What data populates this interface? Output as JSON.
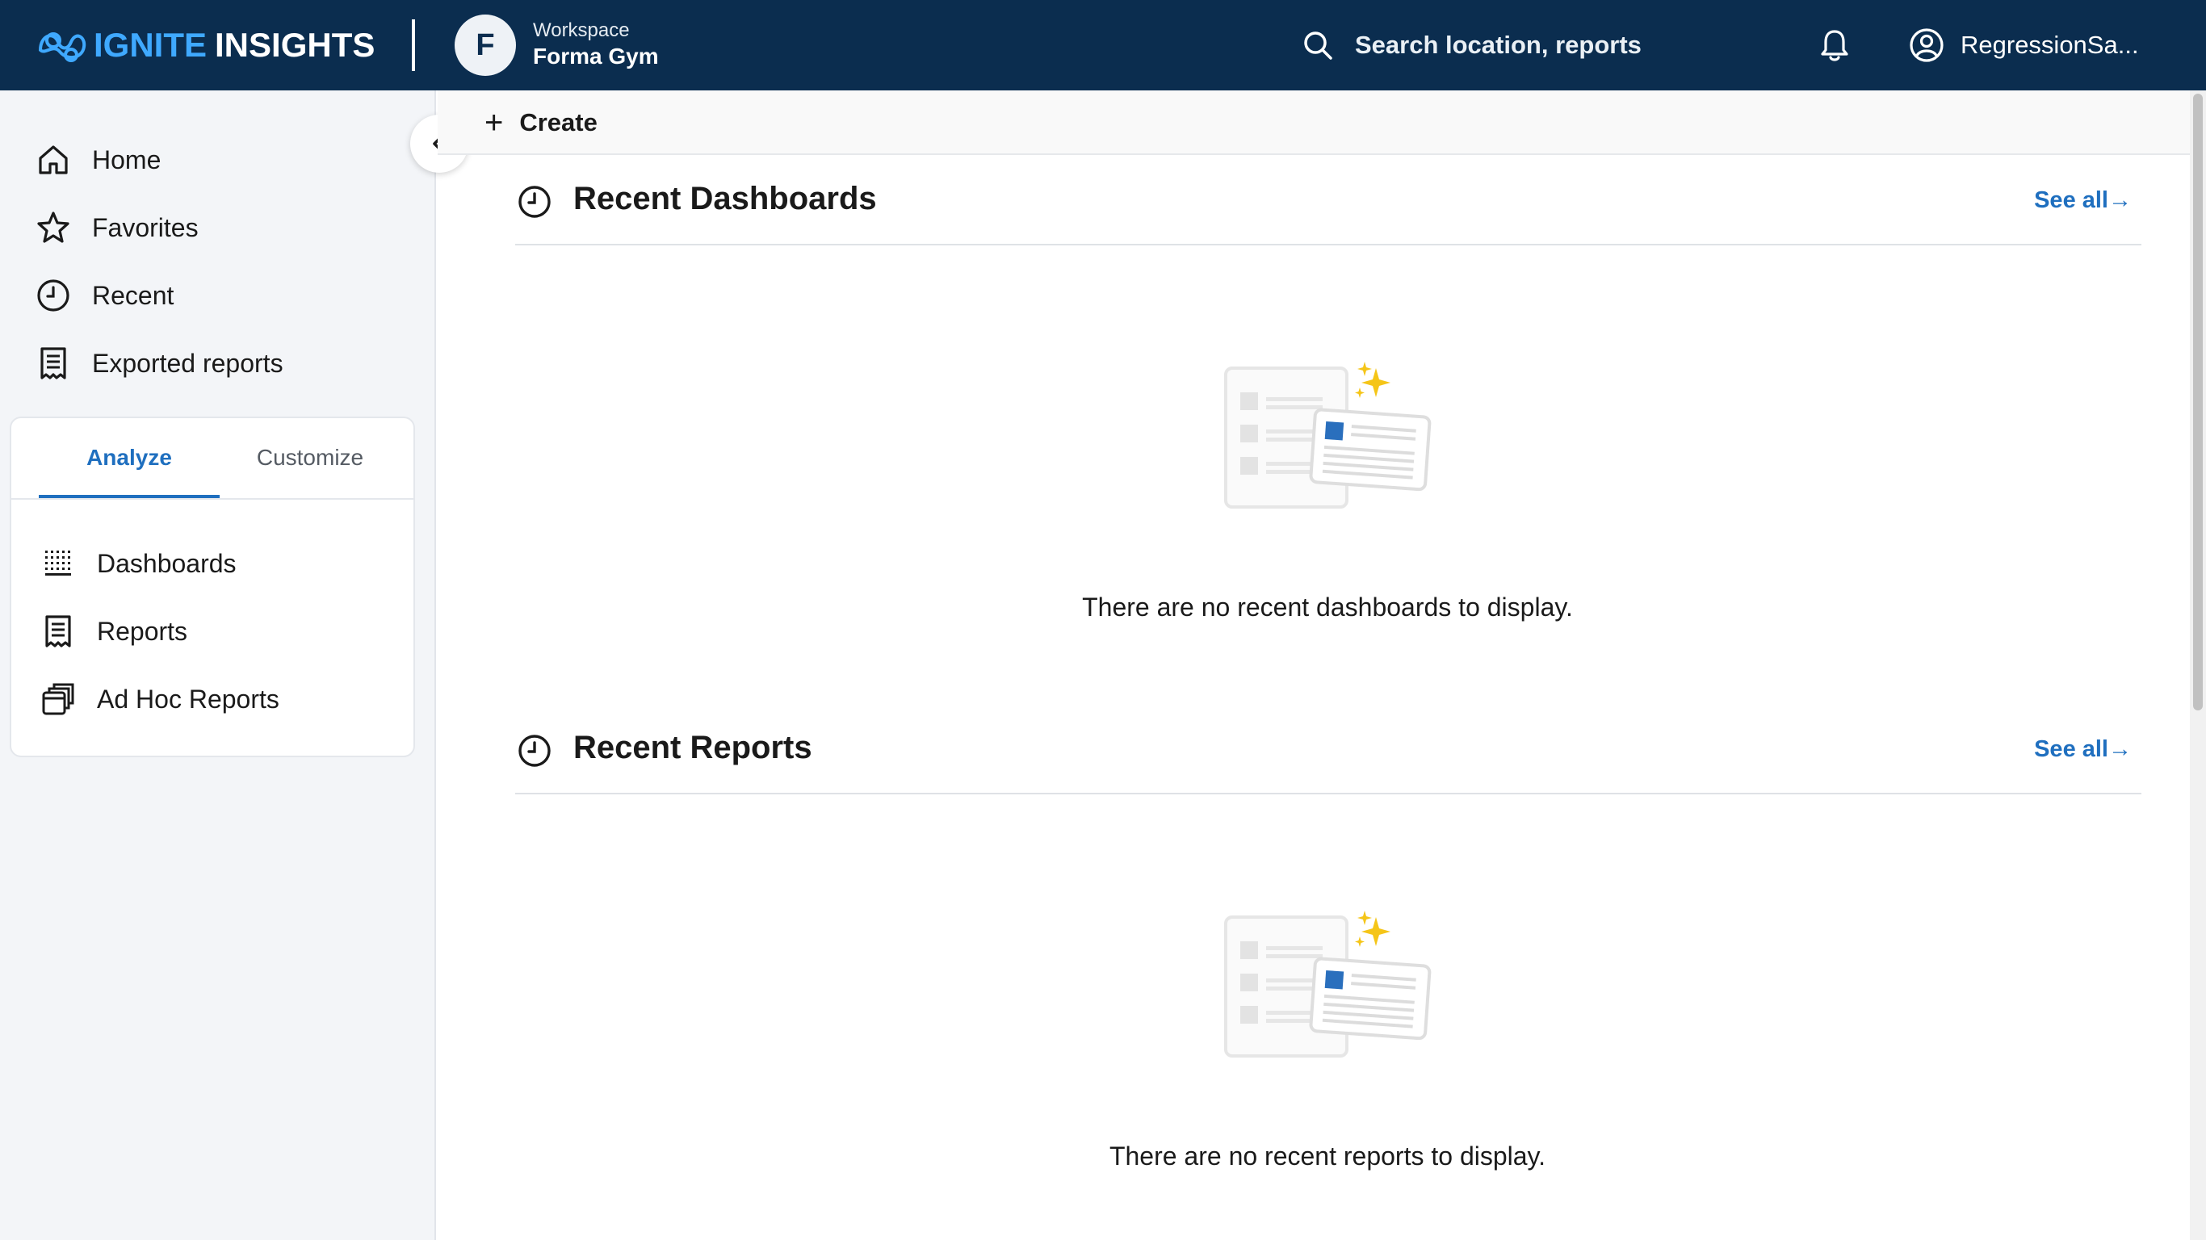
{
  "header": {
    "brand_part1": "IGNITE",
    "brand_part2": "INSIGHTS",
    "workspace_initial": "F",
    "workspace_label": "Workspace",
    "workspace_name": "Forma Gym",
    "search_placeholder": "Search location, reports",
    "user_name": "RegressionSa...",
    "icons": {
      "logo": "ignite-logo-icon",
      "search": "search-icon",
      "bell": "bell-icon",
      "user": "user-circle-icon"
    }
  },
  "sidebar": {
    "items": [
      {
        "label": "Home",
        "icon": "home-icon"
      },
      {
        "label": "Favorites",
        "icon": "star-icon"
      },
      {
        "label": "Recent",
        "icon": "clock-icon"
      },
      {
        "label": "Exported reports",
        "icon": "receipt-icon"
      }
    ],
    "tabs": [
      {
        "label": "Analyze",
        "active": true
      },
      {
        "label": "Customize",
        "active": false
      }
    ],
    "sub_items": [
      {
        "label": "Dashboards",
        "icon": "dotted-grid-icon"
      },
      {
        "label": "Reports",
        "icon": "receipt-icon"
      },
      {
        "label": "Ad Hoc Reports",
        "icon": "stacked-windows-icon"
      }
    ],
    "collapse_icon": "chevron-left-icon"
  },
  "toolbar": {
    "create_label": "Create",
    "create_icon": "plus-icon"
  },
  "sections": [
    {
      "title": "Recent Dashboards",
      "see_all": "See all→",
      "empty_message": "There are no recent dashboards to display.",
      "icon": "clock-icon"
    },
    {
      "title": "Recent Reports",
      "see_all": "See all→",
      "empty_message": "There are no recent reports to display.",
      "icon": "clock-icon"
    }
  ],
  "colors": {
    "topbar": "#0b2d4f",
    "accent": "#1f6fbf",
    "brand_accent": "#3fa9ff",
    "sidebar_bg": "#f3f5f8",
    "sparkle": "#f5c518"
  }
}
